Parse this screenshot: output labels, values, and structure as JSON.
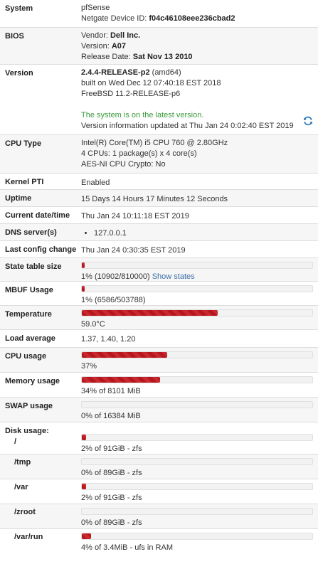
{
  "system": {
    "label": "System",
    "name": "pfSense",
    "device_id_label": "Netgate Device ID:",
    "device_id": "f04c46108eee236cbad2"
  },
  "bios": {
    "label": "BIOS",
    "vendor_label": "Vendor:",
    "vendor": "Dell Inc.",
    "version_label": "Version:",
    "version": "A07",
    "release_label": "Release Date:",
    "release": "Sat Nov 13 2010"
  },
  "version": {
    "label": "Version",
    "release": "2.4.4-RELEASE-p2",
    "arch": "(amd64)",
    "built": "built on Wed Dec 12 07:40:18 EST 2018",
    "freebsd": "FreeBSD 11.2-RELEASE-p6",
    "status": "The system is on the latest version.",
    "updated": "Version information updated at Thu Jan 24 0:02:40 EST 2019",
    "refresh_icon": "refresh-icon"
  },
  "cpu_type": {
    "label": "CPU Type",
    "model": "Intel(R) Core(TM) i5 CPU 760 @ 2.80GHz",
    "cores": "4 CPUs: 1 package(s) x 4 core(s)",
    "aesni": "AES-NI CPU Crypto: No"
  },
  "kernel_pti": {
    "label": "Kernel PTI",
    "value": "Enabled"
  },
  "uptime": {
    "label": "Uptime",
    "value": "15 Days 14 Hours 17 Minutes 12 Seconds"
  },
  "current_datetime": {
    "label": "Current date/time",
    "value": "Thu Jan 24 10:11:18 EST 2019"
  },
  "dns": {
    "label": "DNS server(s)",
    "servers": [
      "127.0.0.1"
    ]
  },
  "last_config": {
    "label": "Last config change",
    "value": "Thu Jan 24 0:30:35 EST 2019"
  },
  "state_table": {
    "label": "State table size",
    "percent": 1,
    "text": "1% (10902/810000)",
    "link": "Show states"
  },
  "mbuf": {
    "label": "MBUF Usage",
    "percent": 1,
    "text": "1% (6586/503788)"
  },
  "temperature": {
    "label": "Temperature",
    "percent": 59,
    "text": "59.0°C"
  },
  "load_average": {
    "label": "Load average",
    "value": "1.37, 1.40, 1.20"
  },
  "cpu_usage": {
    "label": "CPU usage",
    "percent": 37,
    "text": "37%"
  },
  "memory_usage": {
    "label": "Memory usage",
    "percent": 34,
    "text": "34% of 8101 MiB"
  },
  "swap_usage": {
    "label": "SWAP usage",
    "percent": 0,
    "text": "0% of 16384 MiB"
  },
  "disk_usage": {
    "label": "Disk usage:",
    "disks": [
      {
        "mount": "/",
        "percent": 2,
        "text": "2% of 91GiB - zfs"
      },
      {
        "mount": "/tmp",
        "percent": 0,
        "text": "0% of 89GiB - zfs"
      },
      {
        "mount": "/var",
        "percent": 2,
        "text": "2% of 91GiB - zfs"
      },
      {
        "mount": "/zroot",
        "percent": 0,
        "text": "0% of 89GiB - zfs"
      },
      {
        "mount": "/var/run",
        "percent": 4,
        "text": "4% of 3.4MiB - ufs in RAM"
      }
    ]
  },
  "colors": {
    "bar_fill": "#b4181e",
    "status_green": "#3a9b3a",
    "link": "#3a6fa8"
  }
}
